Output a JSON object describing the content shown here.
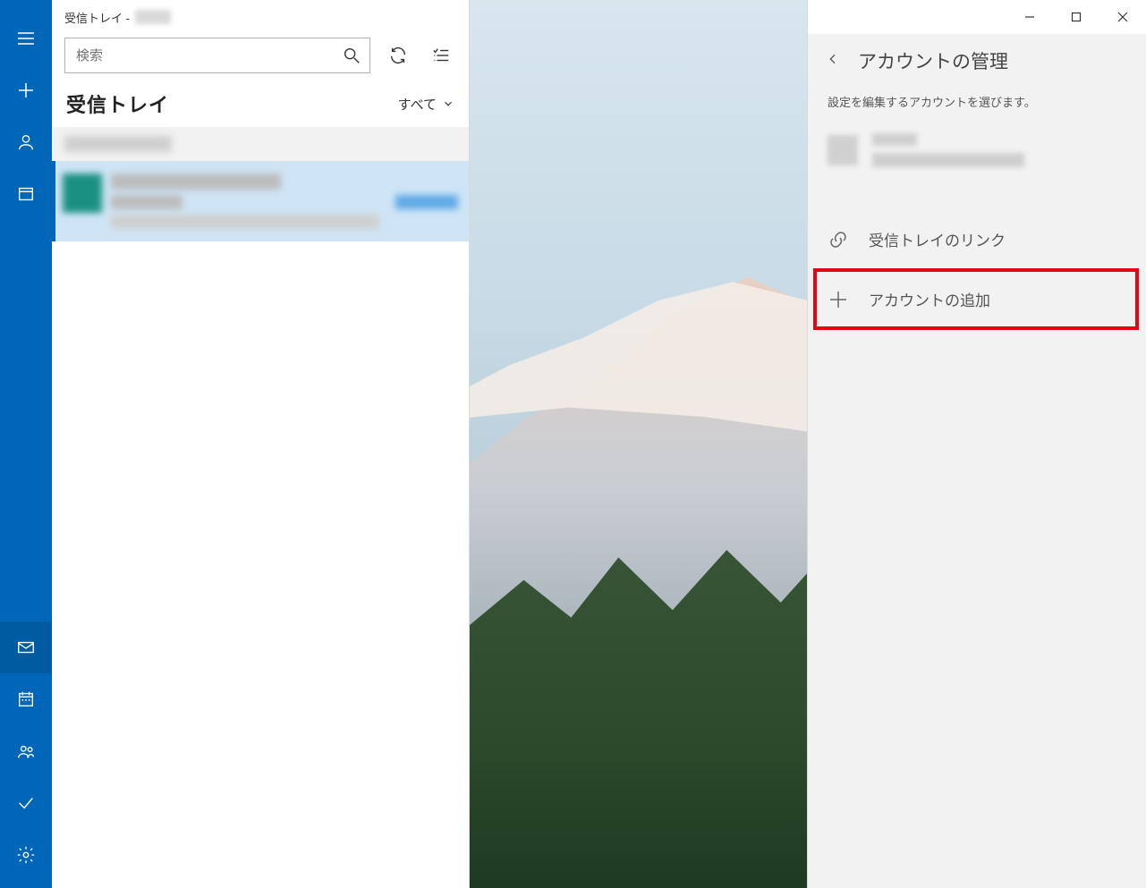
{
  "titlebar": {
    "prefix": "受信トレイ - "
  },
  "search": {
    "placeholder": "検索"
  },
  "inbox": {
    "title": "受信トレイ",
    "filter_label": "すべて"
  },
  "pane": {
    "title": "アカウントの管理",
    "description": "設定を編集するアカウントを選びます。",
    "link_inbox": "受信トレイのリンク",
    "add_account": "アカウントの追加"
  }
}
